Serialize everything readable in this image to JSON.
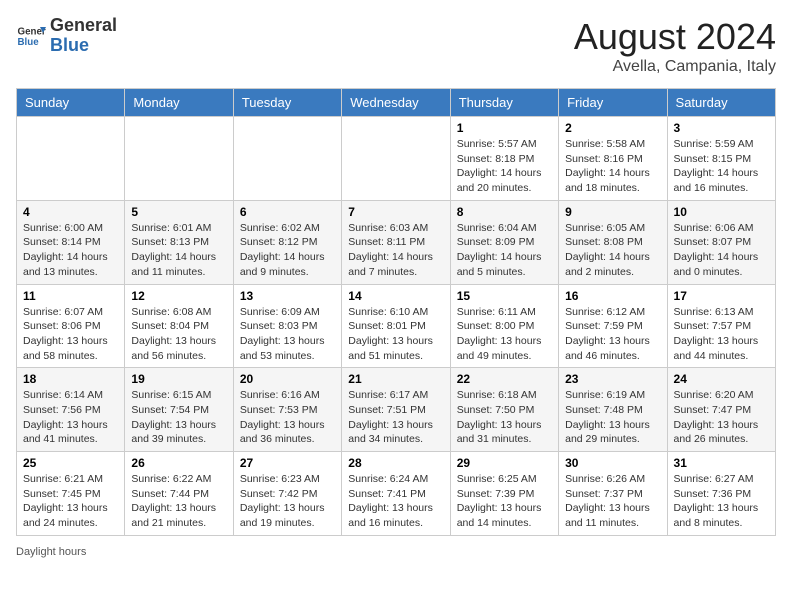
{
  "header": {
    "logo_general": "General",
    "logo_blue": "Blue",
    "main_title": "August 2024",
    "subtitle": "Avella, Campania, Italy"
  },
  "days_of_week": [
    "Sunday",
    "Monday",
    "Tuesday",
    "Wednesday",
    "Thursday",
    "Friday",
    "Saturday"
  ],
  "weeks": [
    [
      {
        "day": "",
        "info": ""
      },
      {
        "day": "",
        "info": ""
      },
      {
        "day": "",
        "info": ""
      },
      {
        "day": "",
        "info": ""
      },
      {
        "day": "1",
        "info": "Sunrise: 5:57 AM\nSunset: 8:18 PM\nDaylight: 14 hours and 20 minutes."
      },
      {
        "day": "2",
        "info": "Sunrise: 5:58 AM\nSunset: 8:16 PM\nDaylight: 14 hours and 18 minutes."
      },
      {
        "day": "3",
        "info": "Sunrise: 5:59 AM\nSunset: 8:15 PM\nDaylight: 14 hours and 16 minutes."
      }
    ],
    [
      {
        "day": "4",
        "info": "Sunrise: 6:00 AM\nSunset: 8:14 PM\nDaylight: 14 hours and 13 minutes."
      },
      {
        "day": "5",
        "info": "Sunrise: 6:01 AM\nSunset: 8:13 PM\nDaylight: 14 hours and 11 minutes."
      },
      {
        "day": "6",
        "info": "Sunrise: 6:02 AM\nSunset: 8:12 PM\nDaylight: 14 hours and 9 minutes."
      },
      {
        "day": "7",
        "info": "Sunrise: 6:03 AM\nSunset: 8:11 PM\nDaylight: 14 hours and 7 minutes."
      },
      {
        "day": "8",
        "info": "Sunrise: 6:04 AM\nSunset: 8:09 PM\nDaylight: 14 hours and 5 minutes."
      },
      {
        "day": "9",
        "info": "Sunrise: 6:05 AM\nSunset: 8:08 PM\nDaylight: 14 hours and 2 minutes."
      },
      {
        "day": "10",
        "info": "Sunrise: 6:06 AM\nSunset: 8:07 PM\nDaylight: 14 hours and 0 minutes."
      }
    ],
    [
      {
        "day": "11",
        "info": "Sunrise: 6:07 AM\nSunset: 8:06 PM\nDaylight: 13 hours and 58 minutes."
      },
      {
        "day": "12",
        "info": "Sunrise: 6:08 AM\nSunset: 8:04 PM\nDaylight: 13 hours and 56 minutes."
      },
      {
        "day": "13",
        "info": "Sunrise: 6:09 AM\nSunset: 8:03 PM\nDaylight: 13 hours and 53 minutes."
      },
      {
        "day": "14",
        "info": "Sunrise: 6:10 AM\nSunset: 8:01 PM\nDaylight: 13 hours and 51 minutes."
      },
      {
        "day": "15",
        "info": "Sunrise: 6:11 AM\nSunset: 8:00 PM\nDaylight: 13 hours and 49 minutes."
      },
      {
        "day": "16",
        "info": "Sunrise: 6:12 AM\nSunset: 7:59 PM\nDaylight: 13 hours and 46 minutes."
      },
      {
        "day": "17",
        "info": "Sunrise: 6:13 AM\nSunset: 7:57 PM\nDaylight: 13 hours and 44 minutes."
      }
    ],
    [
      {
        "day": "18",
        "info": "Sunrise: 6:14 AM\nSunset: 7:56 PM\nDaylight: 13 hours and 41 minutes."
      },
      {
        "day": "19",
        "info": "Sunrise: 6:15 AM\nSunset: 7:54 PM\nDaylight: 13 hours and 39 minutes."
      },
      {
        "day": "20",
        "info": "Sunrise: 6:16 AM\nSunset: 7:53 PM\nDaylight: 13 hours and 36 minutes."
      },
      {
        "day": "21",
        "info": "Sunrise: 6:17 AM\nSunset: 7:51 PM\nDaylight: 13 hours and 34 minutes."
      },
      {
        "day": "22",
        "info": "Sunrise: 6:18 AM\nSunset: 7:50 PM\nDaylight: 13 hours and 31 minutes."
      },
      {
        "day": "23",
        "info": "Sunrise: 6:19 AM\nSunset: 7:48 PM\nDaylight: 13 hours and 29 minutes."
      },
      {
        "day": "24",
        "info": "Sunrise: 6:20 AM\nSunset: 7:47 PM\nDaylight: 13 hours and 26 minutes."
      }
    ],
    [
      {
        "day": "25",
        "info": "Sunrise: 6:21 AM\nSunset: 7:45 PM\nDaylight: 13 hours and 24 minutes."
      },
      {
        "day": "26",
        "info": "Sunrise: 6:22 AM\nSunset: 7:44 PM\nDaylight: 13 hours and 21 minutes."
      },
      {
        "day": "27",
        "info": "Sunrise: 6:23 AM\nSunset: 7:42 PM\nDaylight: 13 hours and 19 minutes."
      },
      {
        "day": "28",
        "info": "Sunrise: 6:24 AM\nSunset: 7:41 PM\nDaylight: 13 hours and 16 minutes."
      },
      {
        "day": "29",
        "info": "Sunrise: 6:25 AM\nSunset: 7:39 PM\nDaylight: 13 hours and 14 minutes."
      },
      {
        "day": "30",
        "info": "Sunrise: 6:26 AM\nSunset: 7:37 PM\nDaylight: 13 hours and 11 minutes."
      },
      {
        "day": "31",
        "info": "Sunrise: 6:27 AM\nSunset: 7:36 PM\nDaylight: 13 hours and 8 minutes."
      }
    ]
  ],
  "footer": {
    "daylight_label": "Daylight hours"
  }
}
